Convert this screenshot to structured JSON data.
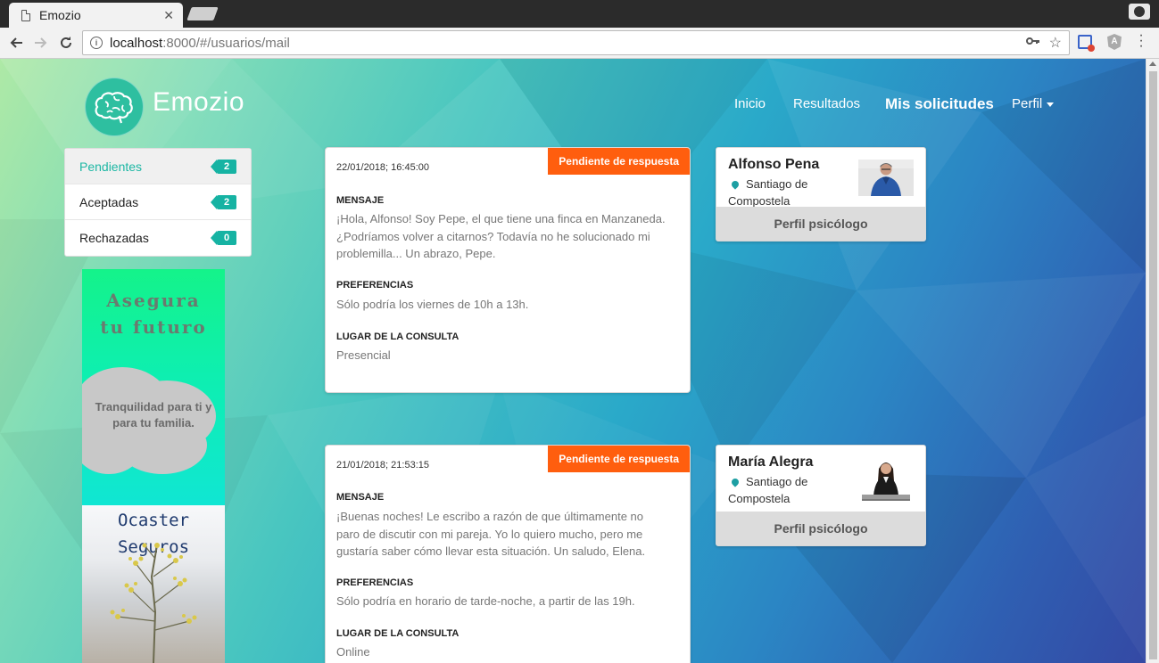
{
  "browser": {
    "tab_title": "Emozio",
    "tab_close": "✕",
    "url_host": "localhost",
    "url_rest": ":8000/#/usuarios/mail",
    "info_glyph": "i",
    "icons": [
      "page-icon",
      "close-icon",
      "new-tab-icon",
      "account-icon",
      "back-icon",
      "forward-icon",
      "reload-icon",
      "info-icon",
      "key-icon",
      "star-icon",
      "extension-icon",
      "angular-icon",
      "menu-icon"
    ]
  },
  "header": {
    "brand": "Emozio",
    "nav": {
      "inicio": "Inicio",
      "resultados": "Resultados",
      "solicitudes": "Mis solicitudes",
      "perfil": "Perfil"
    }
  },
  "filters": [
    {
      "label": "Pendientes",
      "count": "2",
      "active": true
    },
    {
      "label": "Aceptadas",
      "count": "2",
      "active": false
    },
    {
      "label": "Rechazadas",
      "count": "0",
      "active": false
    }
  ],
  "ad": {
    "title_line1": "Asegura",
    "title_line2": "tu futuro",
    "subtitle_line1": "Tranquilidad para ti y",
    "subtitle_line2": "para tu familia.",
    "brand_line1": "Ocaster",
    "brand_line2": "Seguros"
  },
  "requests": [
    {
      "status": "Pendiente de respuesta",
      "date": "22/01/2018; 16:45:00",
      "mensaje_label": "MENSAJE",
      "mensaje": "¡Hola, Alfonso! Soy Pepe, el que tiene una finca en Manzaneda. ¿Podríamos volver a citarnos? Todavía no he solucionado mi problemilla... Un abrazo, Pepe.",
      "preferencias_label": "PREFERENCIAS",
      "preferencias": "Sólo podría los viernes de 10h a 13h.",
      "lugar_label": "LUGAR DE LA CONSULTA",
      "lugar": "Presencial"
    },
    {
      "status": "Pendiente de respuesta",
      "date": "21/01/2018; 21:53:15",
      "mensaje_label": "MENSAJE",
      "mensaje": "¡Buenas noches! Le escribo a razón de que últimamente no paro de discutir con mi pareja. Yo lo quiero mucho, pero me gustaría saber cómo llevar esta situación. Un saludo, Elena.",
      "preferencias_label": "PREFERENCIAS",
      "preferencias": "Sólo podría en horario de tarde-noche, a partir de las 19h.",
      "lugar_label": "LUGAR DE LA CONSULTA",
      "lugar": "Online"
    }
  ],
  "psychologists": [
    {
      "name": "Alfonso Pena",
      "city": "Santiago de Compostela",
      "button": "Perfil psicólogo"
    },
    {
      "name": "María Alegra",
      "city": "Santiago de Compostela",
      "button": "Perfil psicólogo"
    }
  ],
  "colors": {
    "accent": "#16b3a3",
    "status": "#ff5e0e",
    "brand_circle": "#2ebfa0"
  }
}
